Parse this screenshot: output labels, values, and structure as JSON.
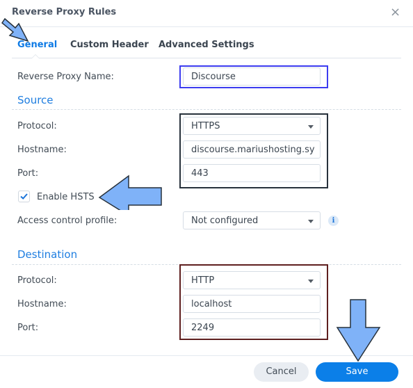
{
  "window": {
    "title": "Reverse Proxy Rules",
    "close_icon": "×"
  },
  "tabs": [
    {
      "label": "General",
      "active": true
    },
    {
      "label": "Custom Header",
      "active": false
    },
    {
      "label": "Advanced Settings",
      "active": false
    }
  ],
  "general": {
    "name_label": "Reverse Proxy Name:",
    "name_value": "Discourse"
  },
  "source": {
    "heading": "Source",
    "protocol_label": "Protocol:",
    "protocol_value": "HTTPS",
    "hostname_label": "Hostname:",
    "hostname_value": "discourse.mariushosting.sy",
    "port_label": "Port:",
    "port_value": "443",
    "hsts_label": "Enable HSTS",
    "hsts_checked": true,
    "access_label": "Access control profile:",
    "access_value": "Not configured",
    "info_icon": "i"
  },
  "destination": {
    "heading": "Destination",
    "protocol_label": "Protocol:",
    "protocol_value": "HTTP",
    "hostname_label": "Hostname:",
    "hostname_value": "localhost",
    "port_label": "Port:",
    "port_value": "2249"
  },
  "footer": {
    "cancel_label": "Cancel",
    "save_label": "Save"
  },
  "annotations": {
    "arrow_color": "#7fb2f8",
    "highlight_colors": [
      "#3c3cf0",
      "#27313b",
      "#5e1f1f"
    ]
  }
}
